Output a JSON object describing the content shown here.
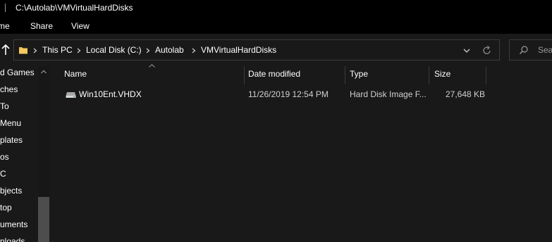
{
  "window": {
    "title": "C:\\Autolab\\VMVirtualHardDisks"
  },
  "ribbon": {
    "tabs": [
      {
        "label": "me"
      },
      {
        "label": "Share"
      },
      {
        "label": "View"
      }
    ]
  },
  "address": {
    "crumbs": [
      {
        "label": "This PC"
      },
      {
        "label": "Local Disk (C:)"
      },
      {
        "label": "Autolab"
      },
      {
        "label": "VMVirtualHardDisks"
      }
    ]
  },
  "search": {
    "placeholder": "Sear"
  },
  "nav": {
    "items": [
      {
        "label": "d Games"
      },
      {
        "label": "ches"
      },
      {
        "label": "To"
      },
      {
        "label": "Menu"
      },
      {
        "label": "plates"
      },
      {
        "label": "os"
      },
      {
        "label": "C"
      },
      {
        "label": "bjects"
      },
      {
        "label": "top"
      },
      {
        "label": "uments"
      },
      {
        "label": "nloads"
      }
    ]
  },
  "columns": {
    "name": "Name",
    "date": "Date modified",
    "type": "Type",
    "size": "Size"
  },
  "files": [
    {
      "name": "Win10Ent.VHDX",
      "date": "11/26/2019 12:54 PM",
      "type": "Hard Disk Image F...",
      "size": "27,648 KB",
      "icon": "hard-disk-image-icon"
    }
  ],
  "colors": {
    "background": "#191919",
    "chrome": "#000000",
    "folder": "#f4c95d",
    "border": "#3c3c3c"
  }
}
